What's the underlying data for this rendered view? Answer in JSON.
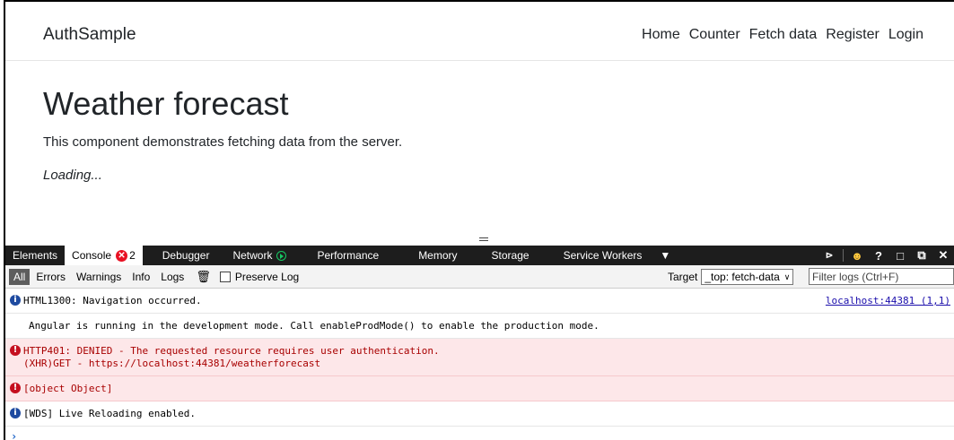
{
  "app": {
    "brand": "AuthSample",
    "nav": [
      "Home",
      "Counter",
      "Fetch data",
      "Register",
      "Login"
    ]
  },
  "page": {
    "title": "Weather forecast",
    "description": "This component demonstrates fetching data from the server.",
    "status": "Loading..."
  },
  "devtools": {
    "tabs": {
      "elements": "Elements",
      "console": "Console",
      "console_errors": "2",
      "debugger": "Debugger",
      "network": "Network",
      "performance": "Performance",
      "memory": "Memory",
      "storage": "Storage",
      "service_workers": "Service Workers"
    },
    "toolbar": {
      "filters": [
        "All",
        "Errors",
        "Warnings",
        "Info",
        "Logs"
      ],
      "preserve_log": "Preserve Log",
      "target_label": "Target",
      "target_value": "_top: fetch-data",
      "filter_placeholder": "Filter logs (Ctrl+F)"
    },
    "messages": [
      {
        "level": "info",
        "text": "HTML1300: Navigation occurred.",
        "source": "localhost:44381 (1,1)"
      },
      {
        "level": "log",
        "text": "Angular is running in the development mode. Call enableProdMode() to enable the production mode."
      },
      {
        "level": "error",
        "text": "HTTP401: DENIED - The requested resource requires user authentication.",
        "text2": "(XHR)GET - https://localhost:44381/weatherforecast"
      },
      {
        "level": "error",
        "text": "[object Object]"
      },
      {
        "level": "info",
        "text": "[WDS] Live Reloading enabled."
      }
    ],
    "prompt": "›"
  },
  "colors": {
    "tab_bar": "#1d1d1d",
    "error_bg": "#fde7e9",
    "error_text": "#a80000",
    "info_icon": "#1e4aa0"
  }
}
